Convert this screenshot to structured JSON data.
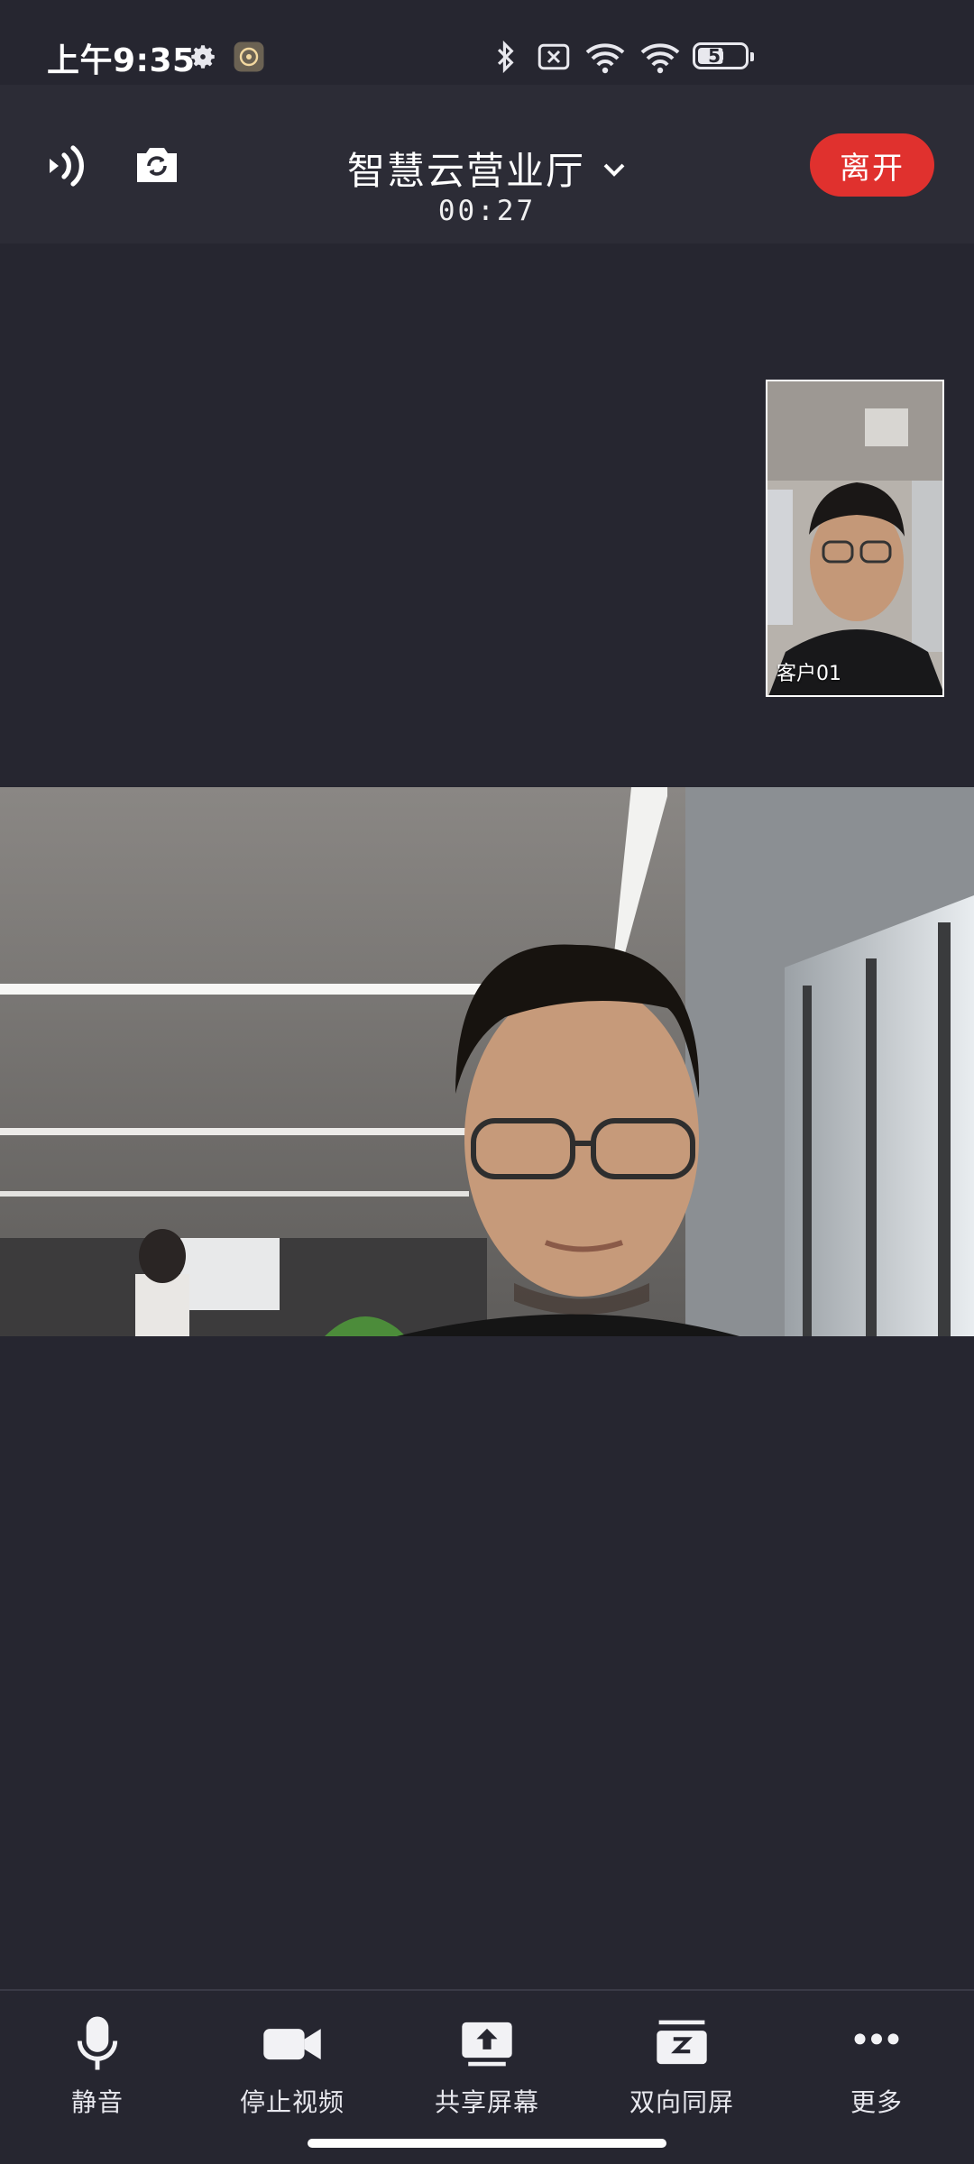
{
  "status_bar": {
    "time": "上午9:35",
    "battery": "51",
    "icons": [
      "settings-icon",
      "app-notification-icon",
      "bluetooth-icon",
      "no-sim-icon",
      "wifi-icon",
      "wifi-icon"
    ]
  },
  "header": {
    "title": "智慧云营业厅",
    "timer": "00:27",
    "leave_label": "离开",
    "icons": [
      "speaker-icon",
      "switch-camera-icon",
      "chevron-down-icon"
    ]
  },
  "thumbnail": {
    "participant_name": "客户01"
  },
  "toolbar": {
    "items": [
      {
        "label": "静音",
        "icon": "microphone-icon"
      },
      {
        "label": "停止视频",
        "icon": "video-camera-icon"
      },
      {
        "label": "共享屏幕",
        "icon": "share-screen-icon"
      },
      {
        "label": "双向同屏",
        "icon": "co-browse-icon"
      },
      {
        "label": "更多",
        "icon": "more-icon"
      }
    ]
  },
  "colors": {
    "background": "#262630",
    "header": "#2c2c36",
    "leave_button": "#e0312e"
  }
}
